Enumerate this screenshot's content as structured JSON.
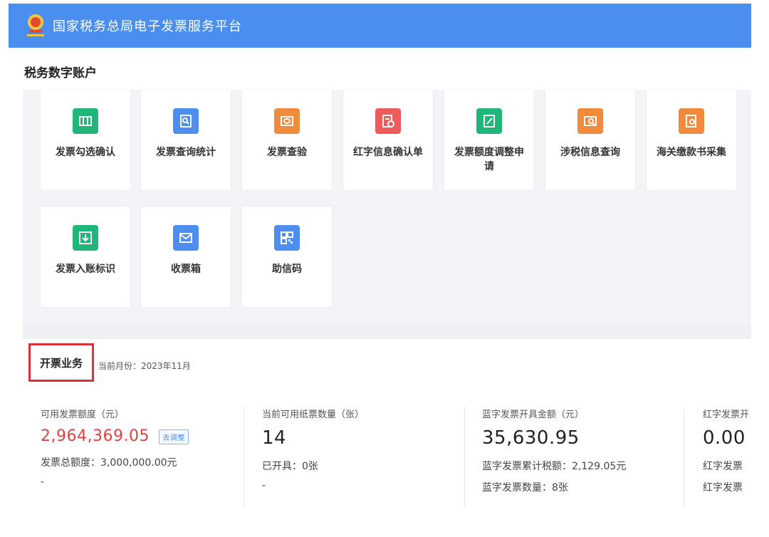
{
  "header": {
    "title": "国家税务总局电子发票服务平台"
  },
  "account": {
    "title": "税务数字账户"
  },
  "tiles": [
    {
      "label": "发票勾选确认",
      "icon": "ticket-icon",
      "color": "#22b57a"
    },
    {
      "label": "发票查询统计",
      "icon": "search-doc-icon",
      "color": "#4d8ef0"
    },
    {
      "label": "发票查验",
      "icon": "verify-icon",
      "color": "#f08a3c"
    },
    {
      "label": "红字信息确认单",
      "icon": "red-form-icon",
      "color": "#ee5b5b"
    },
    {
      "label": "发票额度调整申请",
      "icon": "edit-icon",
      "color": "#22b57a"
    },
    {
      "label": "涉税信息查询",
      "icon": "tax-search-icon",
      "color": "#f08a3c"
    },
    {
      "label": "海关缴款书采集",
      "icon": "customs-icon",
      "color": "#f08a3c"
    },
    {
      "label": "发票入账标识",
      "icon": "download-icon",
      "color": "#22b57a"
    },
    {
      "label": "收票箱",
      "icon": "mail-icon",
      "color": "#4d8ef0"
    },
    {
      "label": "助信码",
      "icon": "qr-icon",
      "color": "#4d8ef0"
    }
  ],
  "business": {
    "title": "开票业务",
    "month_label": "当前月份：2023年11月",
    "stats": [
      {
        "label": "可用发票额度（元）",
        "value": "2,964,369.05",
        "action": "去调整",
        "line1": "发票总额度：3,000,000.00元",
        "line2": "-"
      },
      {
        "label": "当前可用纸票数量（张）",
        "value": "14",
        "line1": "已开具：0张",
        "line2": "-"
      },
      {
        "label": "蓝字发票开具金额（元）",
        "value": "35,630.95",
        "line1": "蓝字发票累计税额：2,129.05元",
        "line2": "蓝字发票数量：8张"
      },
      {
        "label": "红字发票开",
        "value": "0.00",
        "line1": "红字发票",
        "line2": "红字发票"
      }
    ]
  }
}
